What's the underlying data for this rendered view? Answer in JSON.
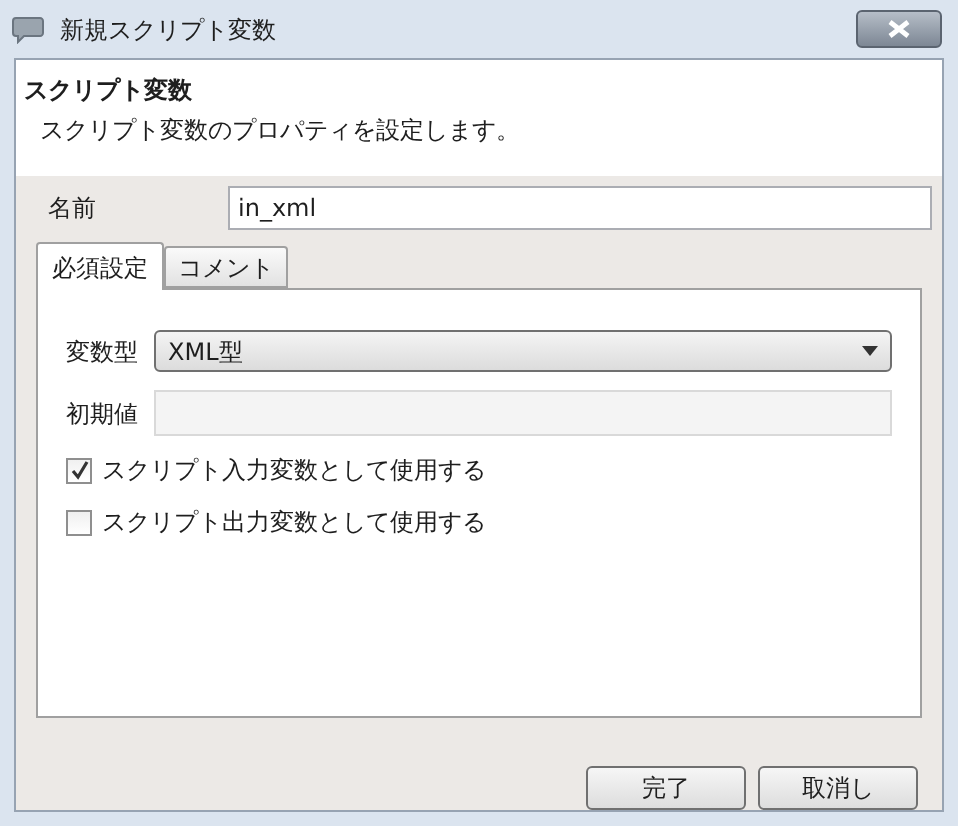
{
  "window": {
    "title": "新規スクリプト変数"
  },
  "header": {
    "title": "スクリプト変数",
    "description": "スクリプト変数のプロパティを設定します。"
  },
  "name_field": {
    "label": "名前",
    "value": "in_xml"
  },
  "tabs": [
    {
      "label": "必須設定",
      "selected": true
    },
    {
      "label": "コメント",
      "selected": false
    }
  ],
  "type_field": {
    "label": "変数型",
    "value": "XML型"
  },
  "initial_value_field": {
    "label": "初期値",
    "disabled": true
  },
  "checkboxes": [
    {
      "label": "スクリプト入力変数として使用する",
      "checked": true
    },
    {
      "label": "スクリプト出力変数として使用する",
      "checked": false
    }
  ],
  "buttons": [
    "完了",
    "取消し"
  ]
}
